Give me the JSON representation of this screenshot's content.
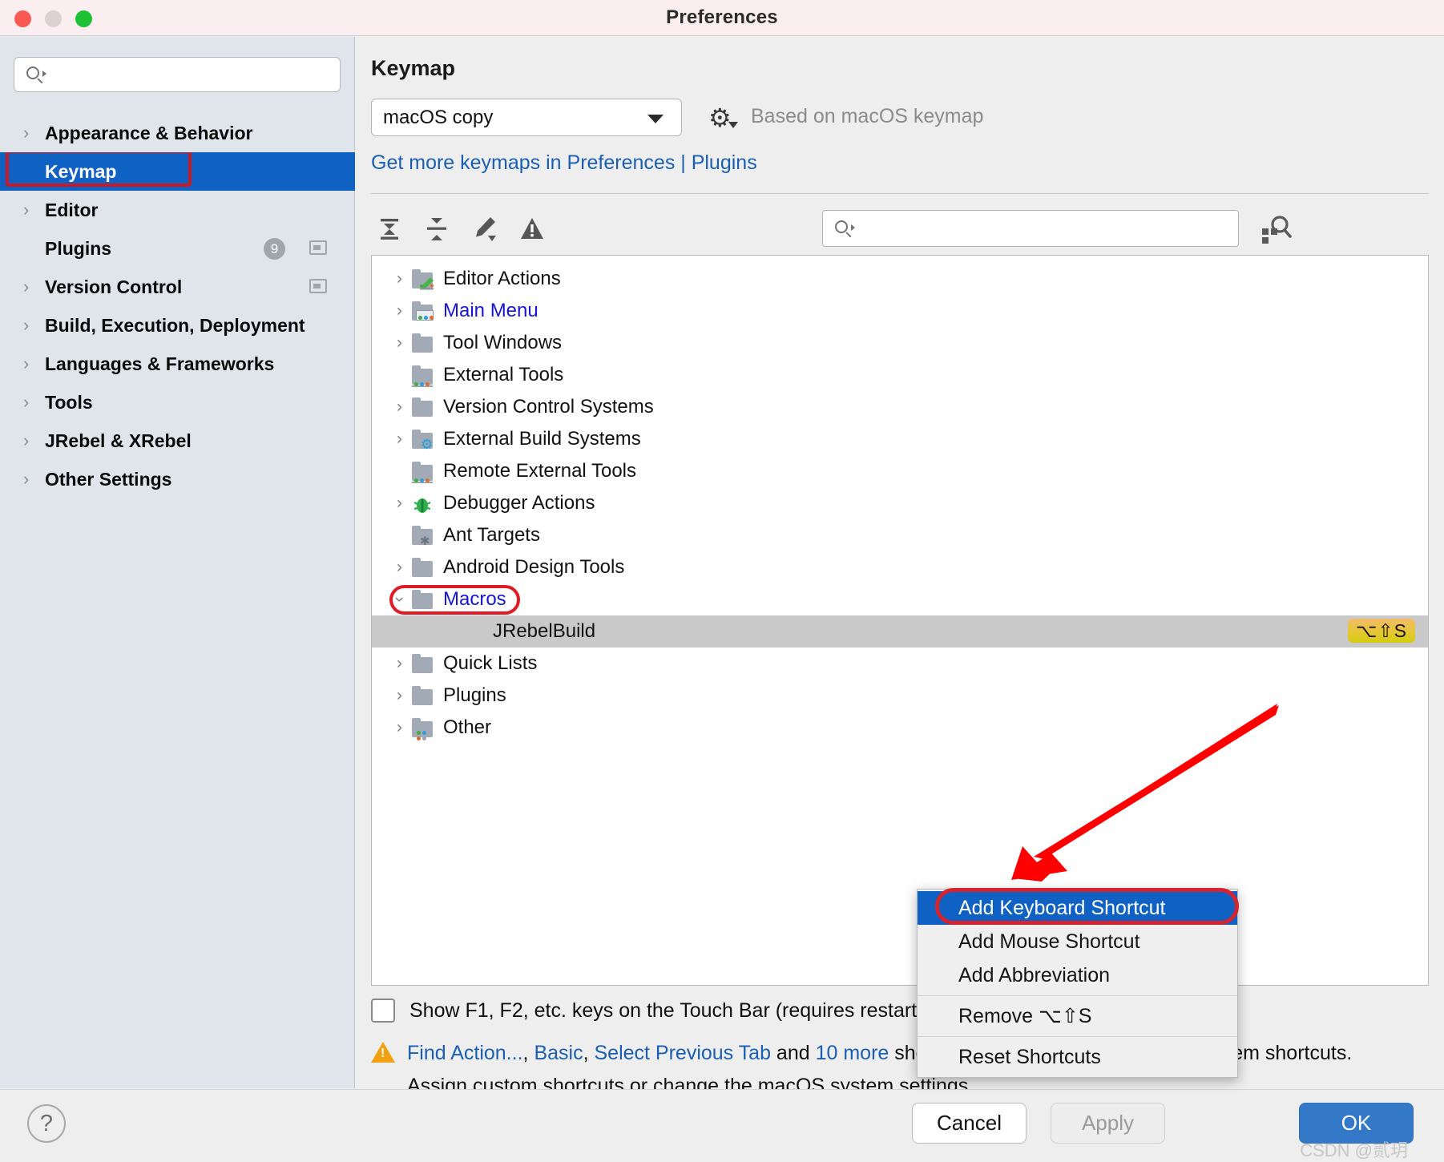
{
  "window": {
    "title": "Preferences",
    "traffic_lights": [
      "close",
      "minimize",
      "zoom"
    ]
  },
  "sidebar": {
    "search_placeholder": "",
    "search_value": "",
    "items": [
      {
        "label": "Appearance & Behavior",
        "expandable": true,
        "selected": false,
        "badge": null,
        "window_icon": false
      },
      {
        "label": "Keymap",
        "expandable": false,
        "selected": true,
        "badge": null,
        "window_icon": false
      },
      {
        "label": "Editor",
        "expandable": true,
        "selected": false,
        "badge": null,
        "window_icon": false
      },
      {
        "label": "Plugins",
        "expandable": false,
        "selected": false,
        "badge": "9",
        "window_icon": true
      },
      {
        "label": "Version Control",
        "expandable": true,
        "selected": false,
        "badge": null,
        "window_icon": true
      },
      {
        "label": "Build, Execution, Deployment",
        "expandable": true,
        "selected": false,
        "badge": null,
        "window_icon": false
      },
      {
        "label": "Languages & Frameworks",
        "expandable": true,
        "selected": false,
        "badge": null,
        "window_icon": false
      },
      {
        "label": "Tools",
        "expandable": true,
        "selected": false,
        "badge": null,
        "window_icon": false
      },
      {
        "label": "JRebel & XRebel",
        "expandable": true,
        "selected": false,
        "badge": null,
        "window_icon": false
      },
      {
        "label": "Other Settings",
        "expandable": true,
        "selected": false,
        "badge": null,
        "window_icon": false
      }
    ]
  },
  "main": {
    "page_title": "Keymap",
    "keymap_selected": "macOS copy",
    "based_on_text": "Based on macOS keymap",
    "get_more_link": "Get more keymaps in Preferences | Plugins",
    "toolbar": {
      "expand_all_title": "Expand All",
      "collapse_all_title": "Collapse All",
      "edit_title": "Edit Shortcut",
      "conflicts_title": "Show Conflicts",
      "search_value": "",
      "search_placeholder": "",
      "find_by_shortcut_title": "Find Actions by Shortcut"
    },
    "tree": [
      {
        "label": "Editor Actions",
        "expandable": true,
        "expanded": false,
        "icon": "folder-edit-icon",
        "link": false,
        "indent": 0
      },
      {
        "label": "Main Menu",
        "expandable": true,
        "expanded": false,
        "icon": "folder-menu-icon",
        "link": true,
        "indent": 0
      },
      {
        "label": "Tool Windows",
        "expandable": true,
        "expanded": false,
        "icon": "folder-icon",
        "link": false,
        "indent": 0
      },
      {
        "label": "External Tools",
        "expandable": false,
        "expanded": false,
        "icon": "folder-tools-icon",
        "link": false,
        "indent": 0
      },
      {
        "label": "Version Control Systems",
        "expandable": true,
        "expanded": false,
        "icon": "folder-icon",
        "link": false,
        "indent": 0
      },
      {
        "label": "External Build Systems",
        "expandable": true,
        "expanded": false,
        "icon": "folder-gear-icon",
        "link": false,
        "indent": 0
      },
      {
        "label": "Remote External Tools",
        "expandable": false,
        "expanded": false,
        "icon": "folder-tools-icon",
        "link": false,
        "indent": 0
      },
      {
        "label": "Debugger Actions",
        "expandable": true,
        "expanded": false,
        "icon": "bug-icon",
        "link": false,
        "indent": 0
      },
      {
        "label": "Ant Targets",
        "expandable": false,
        "expanded": false,
        "icon": "folder-ant-icon",
        "link": false,
        "indent": 0
      },
      {
        "label": "Android Design Tools",
        "expandable": true,
        "expanded": false,
        "icon": "folder-icon",
        "link": false,
        "indent": 0
      },
      {
        "label": "Macros",
        "expandable": true,
        "expanded": true,
        "icon": "folder-icon",
        "link": true,
        "indent": 0,
        "highlighted": true
      },
      {
        "label": "JRebelBuild",
        "expandable": false,
        "expanded": false,
        "icon": "none",
        "link": false,
        "indent": 1,
        "selected": true,
        "shortcut": "⌥⇧S"
      },
      {
        "label": "Quick Lists",
        "expandable": true,
        "expanded": false,
        "icon": "folder-icon",
        "link": false,
        "indent": 0
      },
      {
        "label": "Plugins",
        "expandable": true,
        "expanded": false,
        "icon": "folder-icon",
        "link": false,
        "indent": 0
      },
      {
        "label": "Other",
        "expandable": true,
        "expanded": false,
        "icon": "folder-dots-icon",
        "link": false,
        "indent": 0
      }
    ],
    "context_menu": [
      {
        "label": "Add Keyboard Shortcut",
        "active": true,
        "separator_before": false
      },
      {
        "label": "Add Mouse Shortcut",
        "active": false,
        "separator_before": false
      },
      {
        "label": "Add Abbreviation",
        "active": false,
        "separator_before": false
      },
      {
        "label": "Remove ⌥⇧S",
        "active": false,
        "separator_before": true
      },
      {
        "label": "Reset Shortcuts",
        "active": false,
        "separator_before": true
      }
    ],
    "touchbar_checkbox": {
      "label": "Show F1, F2, etc. keys on the Touch Bar (requires restart)",
      "checked": false
    },
    "conflict_warning": {
      "link1": "Find Action...",
      "sep1": ", ",
      "link2": "Basic",
      "sep2": ", ",
      "link3": "Select Previous Tab",
      "mid": " and ",
      "link4": "10 more",
      "tail": " shortcuts conflict with the macOS system shortcuts.",
      "line2": "Assign custom shortcuts or change the macOS system settings."
    }
  },
  "footer": {
    "help_label": "?",
    "cancel_label": "Cancel",
    "apply_label": "Apply",
    "ok_label": "OK",
    "watermark": "CSDN @贰玥"
  },
  "colors": {
    "accent_blue": "#0f62c4",
    "annotation_red": "#e01b24",
    "link_blue": "#1a5fb4",
    "sidebar_bg": "#dfe5eb",
    "titlebar_bg": "#faeef0",
    "ok_button": "#3479c8",
    "shortcut_badge": "#e9c53e"
  }
}
